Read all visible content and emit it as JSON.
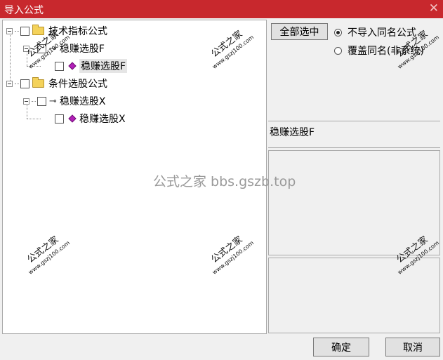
{
  "window": {
    "title": "导入公式",
    "close_glyph": "✕"
  },
  "tree": {
    "nodes": [
      {
        "label": "技术指标公式"
      },
      {
        "label": "稳赚选股F"
      },
      {
        "label": "稳赚选股F"
      },
      {
        "label": "条件选股公式"
      },
      {
        "label": "稳赚选股X"
      },
      {
        "label": "稳赚选股X"
      }
    ]
  },
  "options": {
    "select_all_label": "全部选中",
    "radio_skip_label": "不导入同名公式",
    "radio_overwrite_label": "覆盖同名(非系统)",
    "selected_radio": "skip"
  },
  "details": {
    "formula_name": "稳赚选股F"
  },
  "footer": {
    "ok_label": "确定",
    "cancel_label": "取消"
  },
  "watermark": {
    "brand": "公式之家",
    "url": "www.gszj100.com",
    "center_text": "公式之家 bbs.gszb.top"
  },
  "colors": {
    "titlebar": "#c8282d",
    "gem": "#b21fb8",
    "folder": "#f4d25a"
  },
  "icons": [
    "close-icon",
    "expander-icon",
    "checkbox-icon",
    "folder-icon",
    "key-icon",
    "formula-gem-icon",
    "radio-icon"
  ]
}
